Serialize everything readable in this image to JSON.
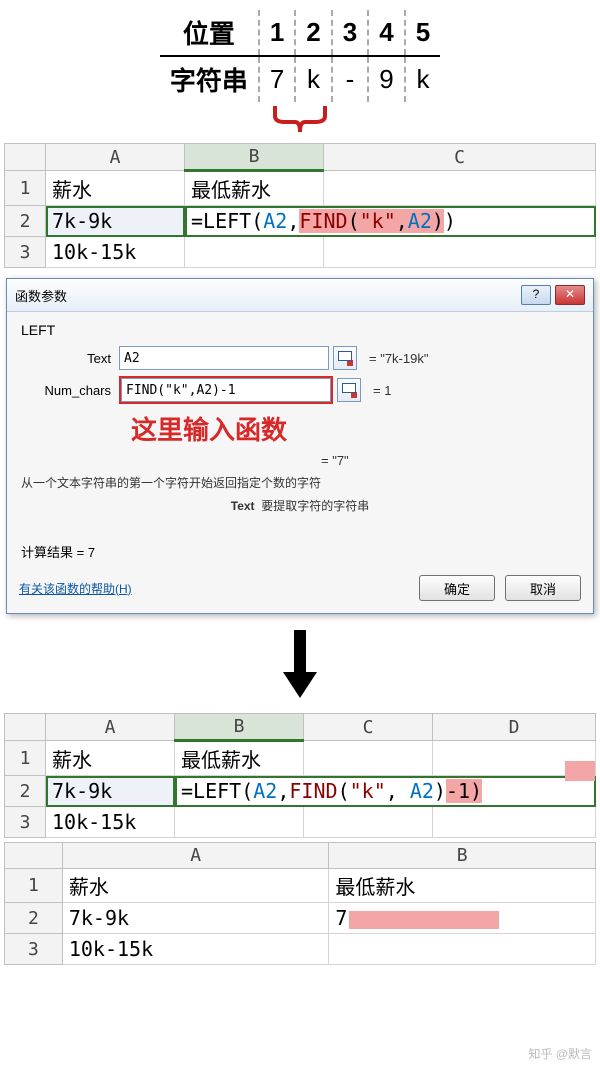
{
  "pos_table": {
    "row1_label": "位置",
    "positions": [
      "1",
      "2",
      "3",
      "4",
      "5"
    ],
    "row2_label": "字符串",
    "chars": [
      "7",
      "k",
      "-",
      "9",
      "k"
    ]
  },
  "excel1": {
    "cols": [
      "A",
      "B",
      "C"
    ],
    "rows": [
      {
        "n": "1",
        "A": "薪水",
        "B": "最低薪水",
        "C": ""
      },
      {
        "n": "2",
        "A": "7k-9k",
        "formula_prefix": "=LEFT(",
        "ref1": "A2",
        "comma": ",",
        "fn": "FIND",
        "open": "(",
        "str": "\"k\"",
        "comma2": ",",
        "ref2": "A2",
        "close": ")",
        "tail": ")"
      },
      {
        "n": "3",
        "A": "10k-15k",
        "B": "",
        "C": ""
      }
    ]
  },
  "dialog": {
    "title": "函数参数",
    "fn": "LEFT",
    "param1_label": "Text",
    "param1_value": "A2",
    "param1_result": "= \"7k-19k\"",
    "param2_label": "Num_chars",
    "param2_value": "FIND(\"k\",A2)-1",
    "param2_result": "= 1",
    "callout": "这里输入函数",
    "eq_result": "= \"7\"",
    "desc1": "从一个文本字符串的第一个字符开始返回指定个数的字符",
    "desc2_label": "Text",
    "desc2_text": "要提取字符的字符串",
    "calc_result_label": "计算结果 = ",
    "calc_result_value": "7",
    "help_link": "有关该函数的帮助(H)",
    "ok": "确定",
    "cancel": "取消"
  },
  "excel2": {
    "cols": [
      "A",
      "B",
      "C",
      "D"
    ],
    "rows": [
      {
        "n": "1",
        "A": "薪水",
        "B": "最低薪水"
      },
      {
        "n": "2",
        "A": "7k-9k",
        "formula_prefix": "=LEFT(",
        "ref1": "A2",
        "comma": ",",
        "fn": "FIND",
        "open": "(",
        "str": "\"k\"",
        "comma2": ", ",
        "ref2": "A2",
        "close": ")",
        "tail": "-1)"
      },
      {
        "n": "3",
        "A": "10k-15k"
      }
    ]
  },
  "excel3": {
    "cols": [
      "A",
      "B"
    ],
    "rows": [
      {
        "n": "1",
        "A": "薪水",
        "B": "最低薪水"
      },
      {
        "n": "2",
        "A": "7k-9k",
        "B": "7"
      },
      {
        "n": "3",
        "A": "10k-15k",
        "B": ""
      }
    ]
  },
  "watermark": "知乎 @默言"
}
